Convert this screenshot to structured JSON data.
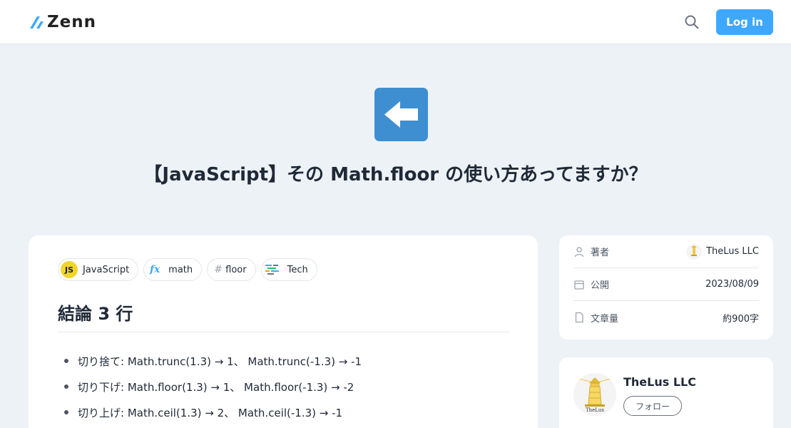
{
  "header": {
    "logo_text": "Zenn",
    "login_label": "Log in"
  },
  "hero": {
    "emoji": "arrow-left-emoji",
    "title": "【JavaScript】その Math.floor の使い方あってますか？"
  },
  "topics": [
    {
      "label": "JavaScript",
      "icon": "javascript-icon"
    },
    {
      "label": "math",
      "icon": "fx-icon"
    },
    {
      "label": "floor",
      "icon": "hash-icon"
    },
    {
      "label": "Tech",
      "icon": "tech-icon"
    }
  ],
  "article": {
    "heading": "結論 3 行",
    "bullets": [
      "切り捨て: Math.trunc(1.3) → 1、 Math.trunc(-1.3) → -1",
      "切り下げ: Math.floor(1.3) → 1、 Math.floor(-1.3) → -2",
      "切り上げ: Math.ceil(1.3) → 2、 Math.ceil(-1.3) → -1"
    ]
  },
  "info": {
    "author_label": "著者",
    "author_value": "TheLus LLC",
    "published_label": "公開",
    "published_value": "2023/08/09",
    "length_label": "文章量",
    "length_value": "約900字"
  },
  "author_card": {
    "name": "TheLus LLC",
    "follow_label": "フォロー",
    "avatar_caption": "TheLus"
  },
  "colors": {
    "accent": "#3ea8ff",
    "background": "#edf2f7",
    "emoji_bg": "#3d8fd1"
  }
}
